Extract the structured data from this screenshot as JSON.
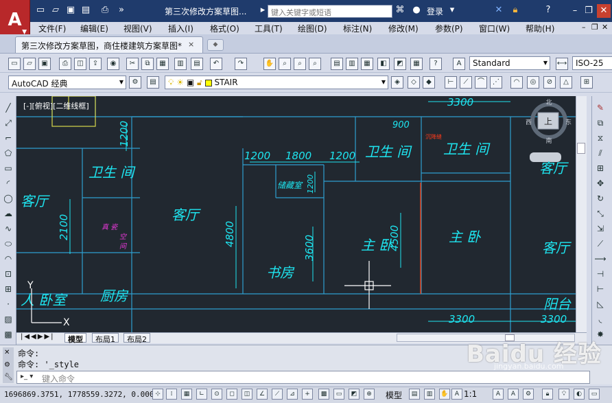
{
  "titlebar": {
    "logo_label": "A",
    "document_title": "第三次修改方案草图...",
    "search_placeholder": "键入关键字或短语",
    "login_label": "登录"
  },
  "menu": [
    "文件(F)",
    "编辑(E)",
    "视图(V)",
    "插入(I)",
    "格式(O)",
    "工具(T)",
    "绘图(D)",
    "标注(N)",
    "修改(M)",
    "参数(P)",
    "窗口(W)",
    "帮助(H)"
  ],
  "doc_tab": {
    "label": "第三次修改方案草图，商住楼建筑方案草图*",
    "close": "×"
  },
  "toolbar": {
    "text_style": "Standard",
    "dim_style": "ISO-25",
    "workspace": "AutoCAD 经典",
    "layer": "STAIR"
  },
  "drawing": {
    "viewport_label": "[-][俯视][二维线框]",
    "rooms": [
      "客厅",
      "卫生 间",
      "客厅",
      "书房",
      "主 卧",
      "主 卧",
      "卫生 间",
      "客厅",
      "客厅",
      "厨房",
      "人 卧室",
      "阳台",
      "储藏室",
      "卫生 间"
    ],
    "dims": [
      "3300",
      "1200",
      "1800",
      "1200",
      "1200",
      "900",
      "2100",
      "4800",
      "3600",
      "4500",
      "3300",
      "3300",
      "1200"
    ],
    "small_labels": [
      "真 瓷",
      "空",
      "间",
      "沉降缝"
    ],
    "navcube": {
      "top": "上",
      "north": "北",
      "south": "南",
      "east": "东",
      "west": "西"
    },
    "axis_x": "X",
    "axis_y": "Y"
  },
  "layout_tabs": [
    "模型",
    "布局1",
    "布局2"
  ],
  "command": {
    "line1": "命令:",
    "line2": "命令: '_style",
    "input_placeholder": "键入命令"
  },
  "status": {
    "coords": "1696869.3751, 1778559.3272, 0.0000",
    "model_label": "模型",
    "scale_label": "1:1"
  },
  "watermark": {
    "main": "Baidu 经验",
    "sub": "jingyan.baidu.com"
  }
}
